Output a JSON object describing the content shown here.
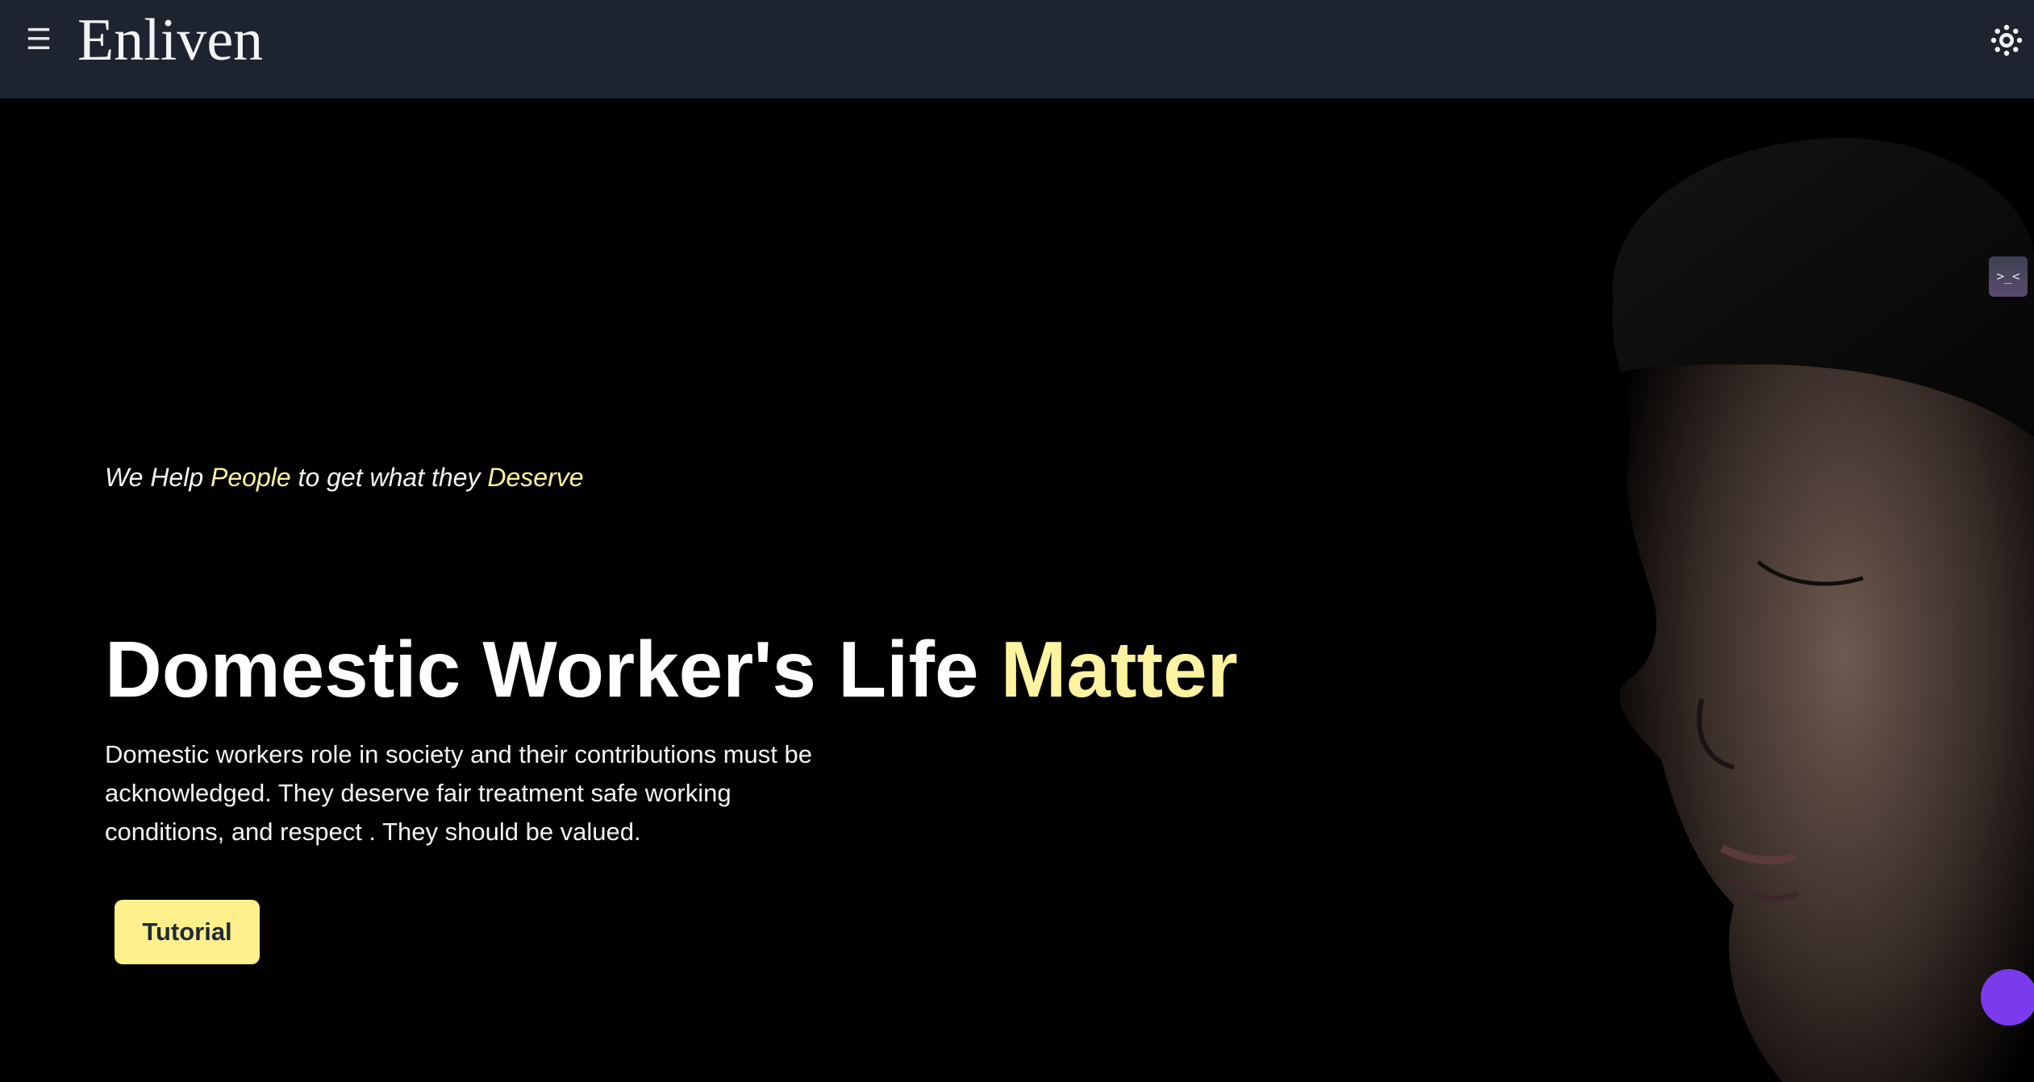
{
  "navbar": {
    "menu_icon": "hamburger-icon",
    "menu_glyph": "☰",
    "brand": "Enliven",
    "theme_icon": "sun-icon"
  },
  "hero": {
    "tagline": {
      "part1": "We Help ",
      "highlight1": "People",
      "part2": " to get what they ",
      "highlight2": "Deserve"
    },
    "headline": {
      "main": "Domestic Worker's Life ",
      "highlight": "Matter"
    },
    "description": "Domestic workers role in society and their contributions must be acknowledged. They deserve fair treatment safe working conditions, and respect . They should be valued.",
    "cta_label": "Tutorial",
    "image_icon": "child-face-portrait"
  },
  "widgets": {
    "dev_glyph": ">_<",
    "dev_icon": "terminal-icon",
    "chat_icon": "chat-bubble-icon"
  },
  "colors": {
    "navbar_bg": "#1e2330",
    "page_bg": "#000000",
    "accent": "#fef3a0",
    "button_bg": "#fdf08a",
    "chat": "#7c3aed"
  }
}
